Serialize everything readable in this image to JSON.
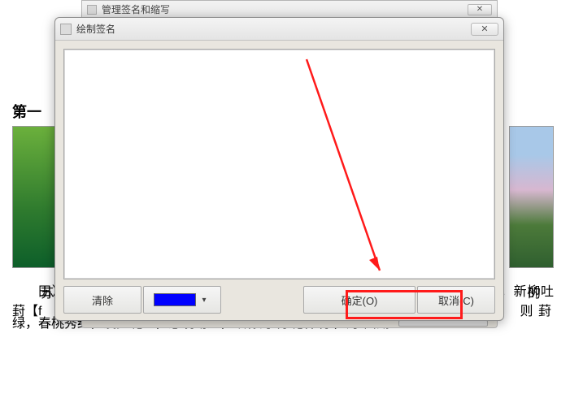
{
  "parentDialog": {
    "title": "管理签名和缩写",
    "close": "✕"
  },
  "dialog": {
    "title": "绘制签名",
    "close": "✕"
  },
  "toolbar": {
    "clear": "清除",
    "color": "#0000ff",
    "ok": "确定(O)",
    "cancel": "取消(C)"
  },
  "document": {
    "heading_fragment": "第一",
    "frag_l1": "苏",
    "frag_l2": "葑【f",
    "frag_r1": "的",
    "frag_r2": "则 葑",
    "para": "田）构筑而成的。堤旁遍种垂柳、碧桃、海棠、芙蓉、紫藤等花木。每到春季，新柳吐绿，春桃秀红，漫步堤上，意境动人，故称为“苏堤春晓”，为“西湖"
  },
  "icons": {
    "app": "app-icon",
    "dropdown": "▾"
  }
}
